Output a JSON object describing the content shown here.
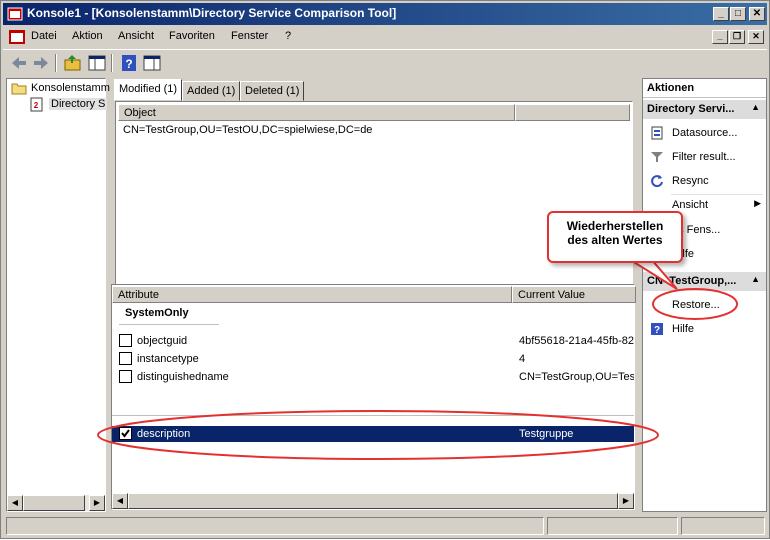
{
  "window": {
    "title": "Konsole1 - [Konsolenstamm\\Directory Service Comparison Tool]"
  },
  "menu": [
    "Datei",
    "Aktion",
    "Ansicht",
    "Favoriten",
    "Fenster",
    "?"
  ],
  "tree": {
    "root": "Konsolenstamm",
    "child": "Directory S"
  },
  "tabs": [
    "Modified (1)",
    "Added (1)",
    "Deleted (1)"
  ],
  "object_list": {
    "column": "Object",
    "rows": [
      "CN=TestGroup,OU=TestOU,DC=spielwiese,DC=de"
    ]
  },
  "attributes": {
    "col_attr": "Attribute",
    "col_value": "Current Value",
    "group": "SystemOnly",
    "rows": [
      {
        "name": "objectguid",
        "value": "4bf55618-21a4-45fb-82c"
      },
      {
        "name": "instancetype",
        "value": "4"
      },
      {
        "name": "distinguishedname",
        "value": "CN=TestGroup,OU=Tes"
      },
      {
        "name": "description",
        "value": "Testgruppe",
        "checked": true,
        "selected": true
      }
    ]
  },
  "actions": {
    "title": "Aktionen",
    "section1": "Directory Servi...",
    "items1": [
      {
        "label": "Datasource...",
        "icon": "datasource-icon"
      },
      {
        "label": "Filter result...",
        "icon": "filter-icon"
      },
      {
        "label": "Resync",
        "icon": "resync-icon"
      },
      {
        "label": "Ansicht",
        "icon": ""
      },
      {
        "label": "es Fens...",
        "icon": ""
      },
      {
        "label": "Hilfe",
        "icon": "help-icon"
      }
    ],
    "section2": "CN=TestGroup,...",
    "items2": [
      {
        "label": "Restore...",
        "icon": ""
      },
      {
        "label": "Hilfe",
        "icon": "help-icon"
      }
    ]
  },
  "callout": {
    "line1": "Wiederherstellen",
    "line2": "des alten Wertes"
  },
  "colors": {
    "title_start": "#0a246a",
    "title_end": "#3a6ea5",
    "highlight": "#e53030",
    "selection": "#0a246a"
  }
}
